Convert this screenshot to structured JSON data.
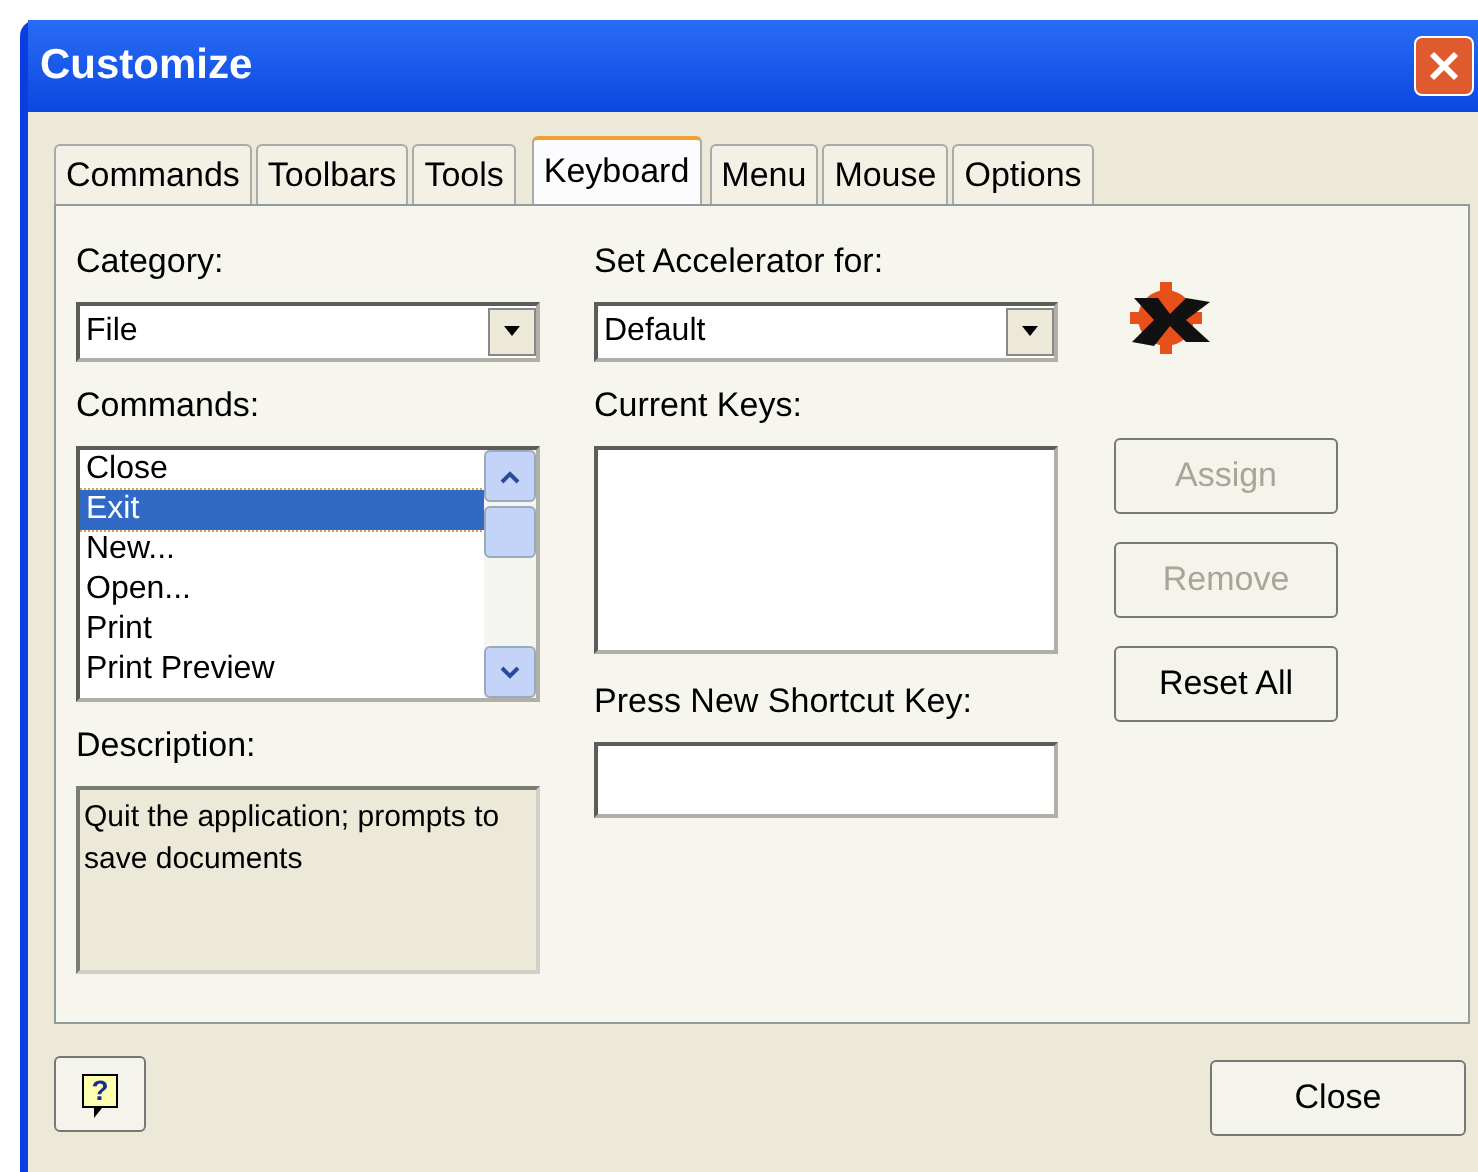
{
  "window": {
    "title": "Customize"
  },
  "tabs": [
    {
      "label": "Commands",
      "selected": false
    },
    {
      "label": "Toolbars",
      "selected": false
    },
    {
      "label": "Tools",
      "selected": false
    },
    {
      "label": "Keyboard",
      "selected": true
    },
    {
      "label": "Menu",
      "selected": false
    },
    {
      "label": "Mouse",
      "selected": false
    },
    {
      "label": "Options",
      "selected": false
    }
  ],
  "category": {
    "label": "Category:",
    "value": "File"
  },
  "commands": {
    "label": "Commands:",
    "items": [
      {
        "label": "Close",
        "selected": false
      },
      {
        "label": "Exit",
        "selected": true
      },
      {
        "label": "New...",
        "selected": false
      },
      {
        "label": "Open...",
        "selected": false
      },
      {
        "label": "Print",
        "selected": false
      },
      {
        "label": "Print Preview",
        "selected": false
      }
    ]
  },
  "description": {
    "label": "Description:",
    "text": "Quit the application; prompts to save documents"
  },
  "accelerator": {
    "label": "Set Accelerator for:",
    "value": "Default"
  },
  "current_keys": {
    "label": "Current Keys:"
  },
  "shortcut": {
    "label": "Press New Shortcut Key:"
  },
  "buttons": [
    {
      "label": "Assign",
      "disabled": true
    },
    {
      "label": "Remove",
      "disabled": true
    },
    {
      "label": "Reset All",
      "disabled": false
    }
  ],
  "help_button": {
    "label": "?"
  },
  "close_button": {
    "label": "Close"
  }
}
